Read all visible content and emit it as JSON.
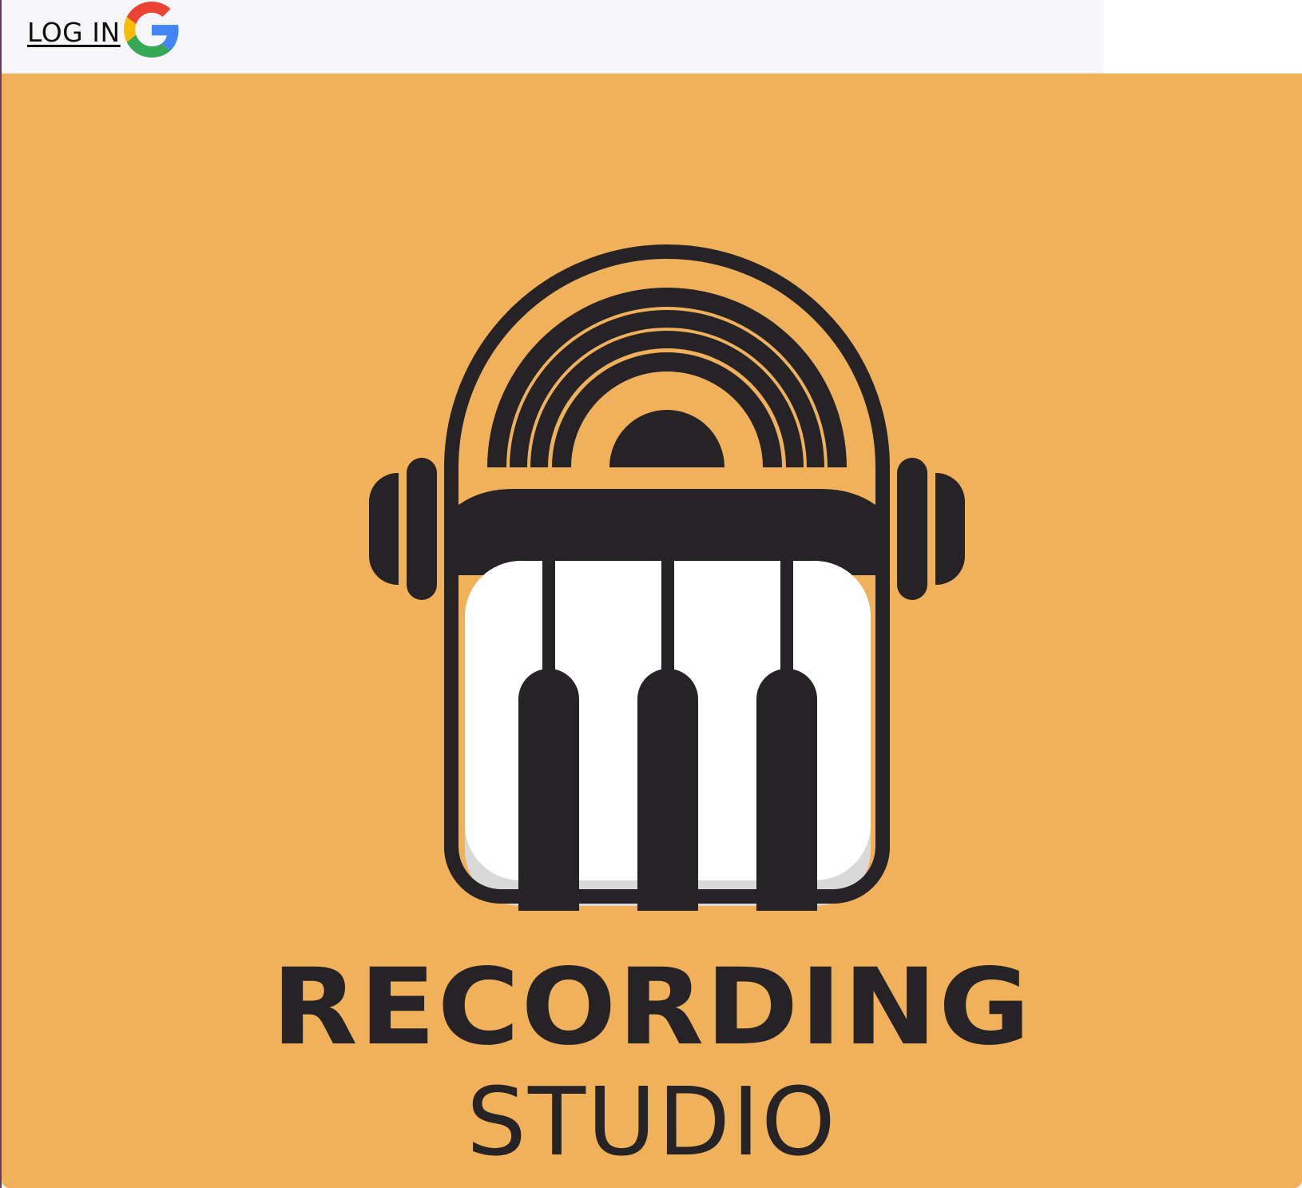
{
  "header": {
    "login_label": "LOG IN",
    "login_icon": "google-g-icon"
  },
  "logo": {
    "title_main": "RECORDING",
    "title_sub": "STUDIO",
    "icon": "headphones-piano-vinyl-icon"
  },
  "colors": {
    "banner_background": "#f0b15a",
    "ink": "#252326",
    "key_white": "#ffffff",
    "key_shadow": "#d9d9d9",
    "topbar_background": "#f7f7f9",
    "google_red": "#ea4335",
    "google_yellow": "#fbbc05",
    "google_green": "#34a853",
    "google_blue": "#4285f4"
  }
}
